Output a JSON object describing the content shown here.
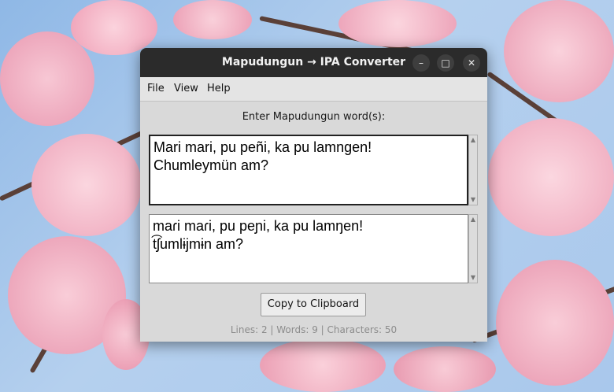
{
  "window": {
    "title": "Mapudungun → IPA Converter",
    "controls": {
      "minimize": "–",
      "maximize": "□",
      "close": "✕"
    }
  },
  "menu": {
    "file": "File",
    "view": "View",
    "help": "Help"
  },
  "prompt": "Enter Mapudungun word(s):",
  "input_text": "Mari mari, pu peñi, ka pu lamngen!\nChumleymün am?",
  "output_text": "maɾi maɾi, pu peɲi, ka pu lamŋen!\nt͡ʃumlɨjmɨn am?",
  "copy_button": "Copy to Clipboard",
  "status": "Lines: 2 | Words: 9 | Characters: 50",
  "icons": {
    "scroll_up": "scroll-up-icon",
    "scroll_down": "scroll-down-icon"
  },
  "colors": {
    "titlebar": "#2b2b2b",
    "window_bg": "#d9d9d9",
    "status_text": "#8c8c8c"
  }
}
